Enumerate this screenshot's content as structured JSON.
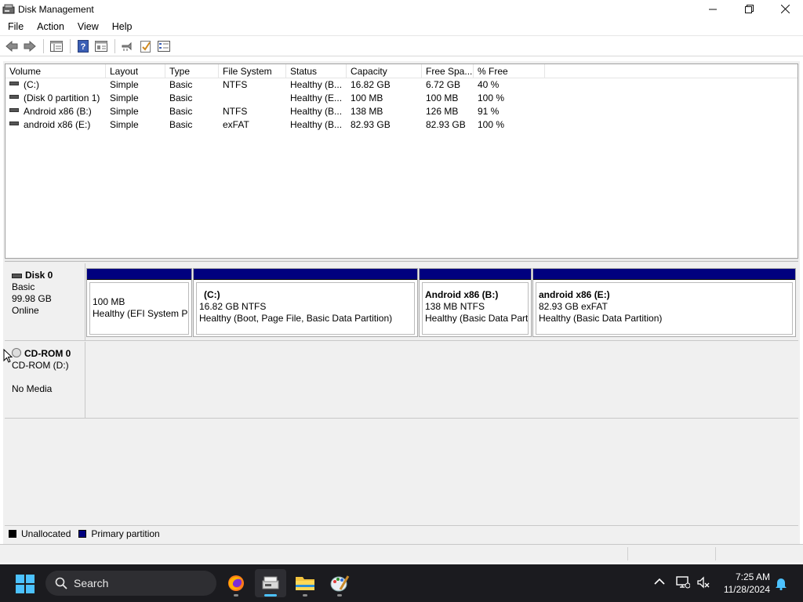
{
  "window": {
    "title": "Disk Management"
  },
  "menu": [
    "File",
    "Action",
    "View",
    "Help"
  ],
  "volume_list": {
    "columns": [
      "Volume",
      "Layout",
      "Type",
      "File System",
      "Status",
      "Capacity",
      "Free Spa...",
      "% Free"
    ],
    "rows": [
      {
        "volume": "(C:)",
        "layout": "Simple",
        "type": "Basic",
        "fs": "NTFS",
        "status": "Healthy (B...",
        "capacity": "16.82 GB",
        "free": "6.72 GB",
        "pct": "40 %"
      },
      {
        "volume": "(Disk 0 partition 1)",
        "layout": "Simple",
        "type": "Basic",
        "fs": "",
        "status": "Healthy (E...",
        "capacity": "100 MB",
        "free": "100 MB",
        "pct": "100 %"
      },
      {
        "volume": "Android x86 (B:)",
        "layout": "Simple",
        "type": "Basic",
        "fs": "NTFS",
        "status": "Healthy (B...",
        "capacity": "138 MB",
        "free": "126 MB",
        "pct": "91 %"
      },
      {
        "volume": "android x86 (E:)",
        "layout": "Simple",
        "type": "Basic",
        "fs": "exFAT",
        "status": "Healthy (B...",
        "capacity": "82.93 GB",
        "free": "82.93 GB",
        "pct": "100 %"
      }
    ]
  },
  "disks": [
    {
      "name": "Disk 0",
      "type": "Basic",
      "size": "99.98 GB",
      "state": "Online",
      "partitions": [
        {
          "name": "",
          "size": "100 MB",
          "status": "Healthy (EFI System Pa"
        },
        {
          "name": "(C:)",
          "size": "16.82 GB NTFS",
          "status": "Healthy (Boot, Page File, Basic Data Partition)"
        },
        {
          "name": "Android x86  (B:)",
          "size": "138 MB NTFS",
          "status": "Healthy (Basic Data Parti"
        },
        {
          "name": "android x86  (E:)",
          "size": "82.93 GB exFAT",
          "status": "Healthy (Basic Data Partition)"
        }
      ]
    },
    {
      "name": "CD-ROM 0",
      "type": "CD-ROM (D:)",
      "media": "No Media"
    }
  ],
  "legend": [
    {
      "label": "Unallocated",
      "color": "#000000"
    },
    {
      "label": "Primary partition",
      "color": "#00007f"
    }
  ],
  "taskbar": {
    "search_placeholder": "Search",
    "time": "7:25 AM",
    "date": "11/28/2024"
  }
}
